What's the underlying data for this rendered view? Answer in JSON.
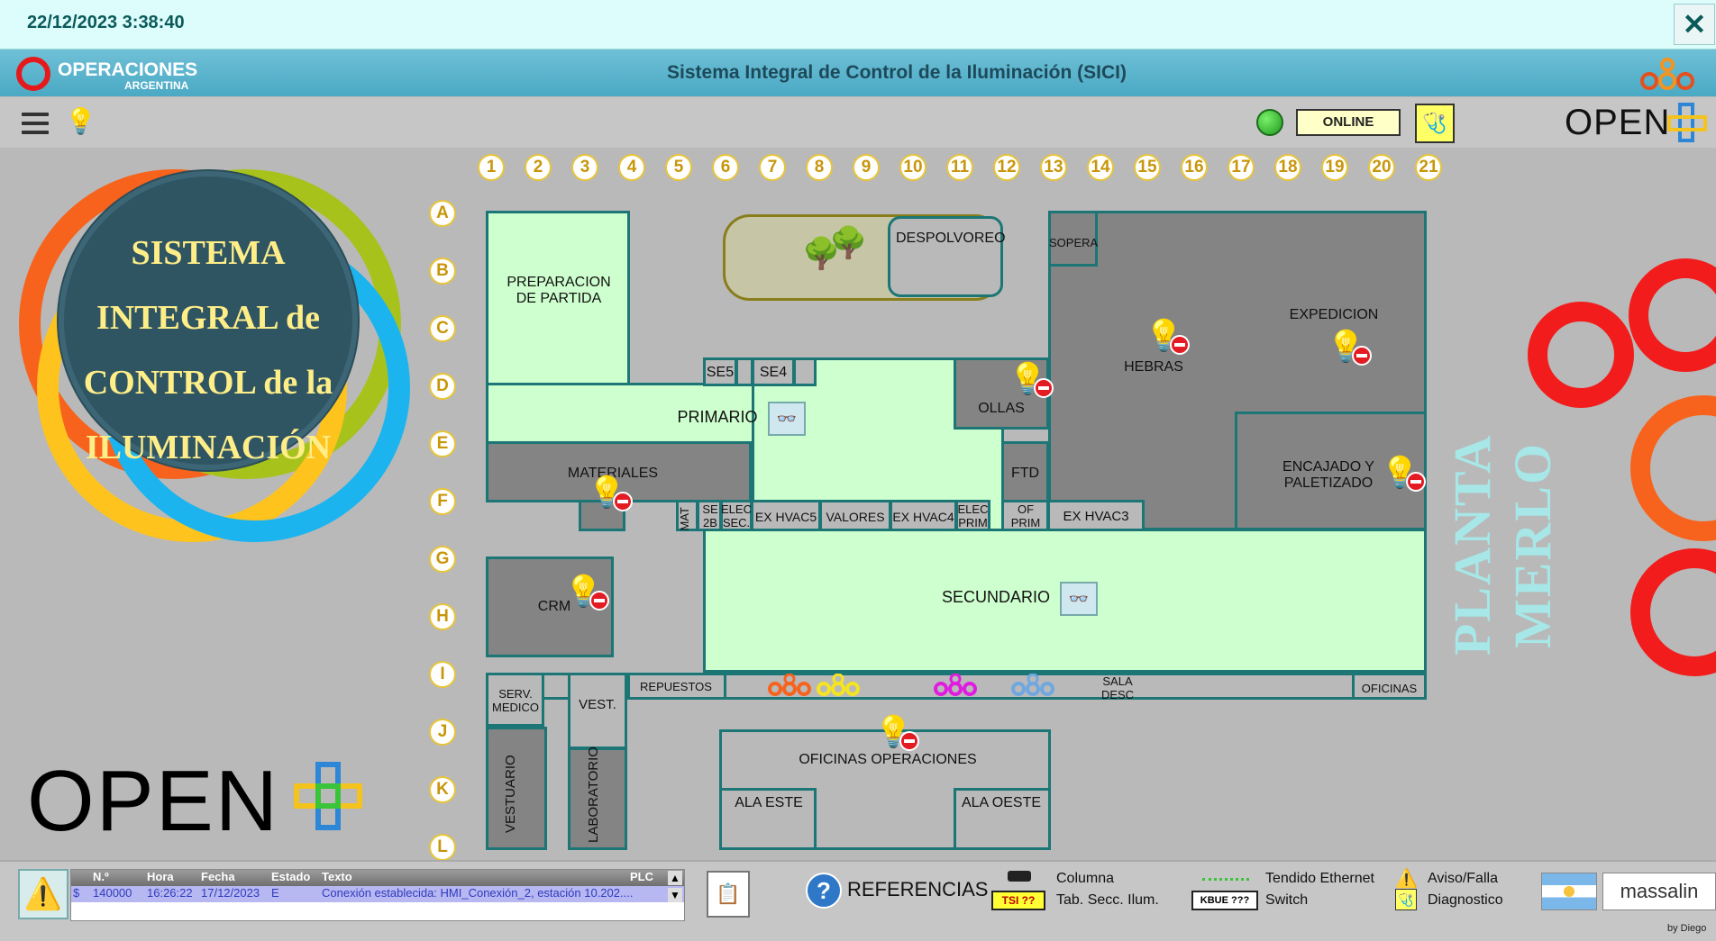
{
  "topbar": {
    "datetime": "22/12/2023 3:38:40"
  },
  "header": {
    "brand": "OPERACIONES",
    "brand_sub": "ARGENTINA",
    "title": "Sistema Integral de Control de la Iluminación (SICI)"
  },
  "toolbar": {
    "status": "ONLINE",
    "logo": "OPEN"
  },
  "logo_lines": [
    "SISTEMA",
    "INTEGRAL de",
    "CONTROL de la",
    "ILUMINACIÓN"
  ],
  "bottom_logo": "OPEN",
  "plant": "PLANTA MERLO",
  "grid": {
    "cols": [
      "1",
      "2",
      "3",
      "4",
      "5",
      "6",
      "7",
      "8",
      "9",
      "10",
      "11",
      "12",
      "13",
      "14",
      "15",
      "16",
      "17",
      "18",
      "19",
      "20",
      "21"
    ],
    "rows": [
      "A",
      "B",
      "C",
      "D",
      "E",
      "F",
      "G",
      "H",
      "I",
      "J",
      "K",
      "L"
    ]
  },
  "areas": {
    "prep": "PREPARACION DE PARTIDA",
    "despolvoreo": "DESPOLVOREO",
    "sopera": "SOPERA",
    "expedicion": "EXPEDICION",
    "hebras": "HEBRAS",
    "se5": "SE5",
    "se4": "SE4",
    "ollas": "OLLAS",
    "primario": "PRIMARIO",
    "materiales": "MATERIALES",
    "ftd": "FTD",
    "encajado": "ENCAJADO Y PALETIZADO",
    "mat": "MAT",
    "se2b": "SE 2B",
    "elec_sec": "ELEC SEC.",
    "ex_hvac5": "EX HVAC5",
    "valores": "VALORES",
    "ex_hvac4": "EX HVAC4",
    "elec_prim": "ELEC PRIM",
    "of_prim": "OF PRIM",
    "ex_hvac3": "EX HVAC3",
    "crm": "CRM",
    "secundario": "SECUNDARIO",
    "serv_medico": "SERV. MEDICO",
    "vest": "VEST.",
    "repuestos": "REPUESTOS",
    "sala_desc": "SALA DESC",
    "oficinas": "OFICINAS",
    "oficinas_operaciones": "OFICINAS OPERACIONES",
    "vestuario": "VESTUARIO",
    "laboratorio": "LABORATORIO",
    "ala_este": "ALA ESTE",
    "ala_oeste": "ALA OESTE"
  },
  "alarms": {
    "headers": [
      "N.º",
      "Hora",
      "Fecha",
      "Estado",
      "Texto",
      "PLC"
    ],
    "rows": [
      {
        "flag": "$",
        "num": "140000",
        "hora": "16:26:22",
        "fecha": "17/12/2023",
        "estado": "E",
        "texto": "Conexión establecida: HMI_Conexión_2, estación 10.202...."
      }
    ]
  },
  "legend": {
    "referencias": "REFERENCIAS",
    "columna": "Columna",
    "tsi": "TSI ??",
    "tab_secc": "Tab. Secc. Ilum.",
    "tendido": "Tendido Ethernet",
    "kbue": "KBUE ???",
    "switch": "Switch",
    "aviso": "Aviso/Falla",
    "diagnostico": "Diagnostico"
  },
  "footer": {
    "brand": "massalin",
    "by": "by Diego"
  },
  "colors": {
    "light_area": "#ceffce",
    "dark_area": "#848484",
    "wall": "#1c7676",
    "accent": "#4aa9c4",
    "alarm_red": "#e31b23"
  }
}
